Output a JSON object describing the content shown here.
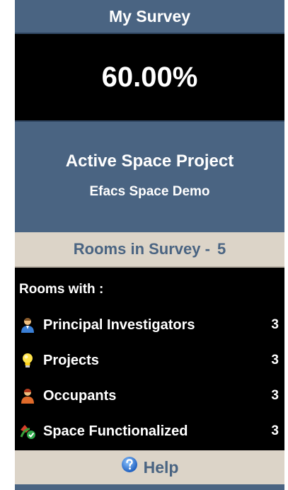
{
  "survey": {
    "title": "My Survey",
    "percent": "60.00%"
  },
  "project": {
    "title": "Active Space Project",
    "name": "Efacs Space Demo"
  },
  "rooms": {
    "label": "Rooms in Survey -",
    "count": "5"
  },
  "rooms_with": {
    "label": "Rooms with :",
    "items": [
      {
        "label": "Principal Investigators",
        "value": "3",
        "icon": "person-icon"
      },
      {
        "label": "Projects",
        "value": "3",
        "icon": "lightbulb-icon"
      },
      {
        "label": "Occupants",
        "value": "3",
        "icon": "person-icon"
      },
      {
        "label": "Space Functionalized",
        "value": "3",
        "icon": "functionalized-check-icon"
      }
    ]
  },
  "help": {
    "label": "Help",
    "icon": "help-icon"
  },
  "colors": {
    "header_bg": "#4a6482",
    "beige_bg": "#dcd4c8",
    "panel_bg": "#000000",
    "text_light": "#ffffff",
    "text_blue": "#4a6482"
  }
}
